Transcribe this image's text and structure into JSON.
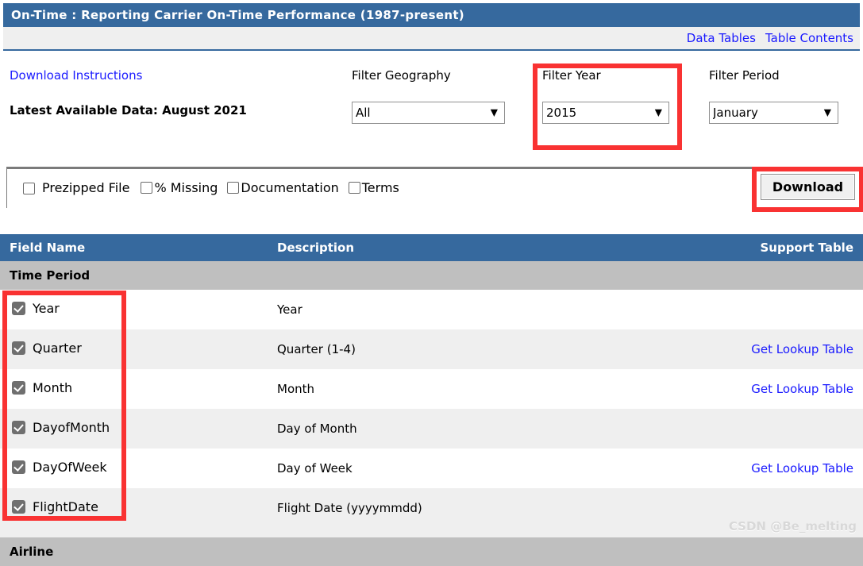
{
  "window": {
    "title": "On-Time : Reporting Carrier On-Time Performance (1987-present)"
  },
  "colors": {
    "header_blue": "#36699e",
    "group_gray": "#bfbfbf",
    "link_blue": "#1a1aff",
    "highlight_red": "#f93232",
    "row_alt": "#efefef"
  },
  "nav_links": [
    {
      "label": "Data Tables"
    },
    {
      "label": "Table Contents"
    }
  ],
  "left_panel": {
    "download_instructions": "Download Instructions",
    "latest_available": "Latest Available Data: August 2021"
  },
  "filters": [
    {
      "id": "geography",
      "label": "Filter Geography",
      "value": "All",
      "options": [
        "All"
      ],
      "highlighted": false
    },
    {
      "id": "year",
      "label": "Filter Year",
      "value": "2015",
      "options": [
        "2015"
      ],
      "highlighted": true
    },
    {
      "id": "period",
      "label": "Filter Period",
      "value": "January",
      "options": [
        "January"
      ],
      "highlighted": false
    }
  ],
  "options": [
    {
      "id": "prezipped",
      "label": "Prezipped File",
      "checked": false
    },
    {
      "id": "missing",
      "label": "% Missing",
      "checked": false
    },
    {
      "id": "documentation",
      "label": "Documentation",
      "checked": false
    },
    {
      "id": "terms",
      "label": "Terms",
      "checked": false
    }
  ],
  "download_button": {
    "label": "Download"
  },
  "table": {
    "columns": {
      "field_name": "Field Name",
      "description": "Description",
      "support_table": "Support Table"
    },
    "groups": [
      {
        "name": "Time Period",
        "rows": [
          {
            "field": "Year",
            "checked": true,
            "description": "Year",
            "support": ""
          },
          {
            "field": "Quarter",
            "checked": true,
            "description": "Quarter (1-4)",
            "support": "Get Lookup Table"
          },
          {
            "field": "Month",
            "checked": true,
            "description": "Month",
            "support": "Get Lookup Table"
          },
          {
            "field": "DayofMonth",
            "checked": true,
            "description": "Day of Month",
            "support": ""
          },
          {
            "field": "DayOfWeek",
            "checked": true,
            "description": "Day of Week",
            "support": "Get Lookup Table"
          },
          {
            "field": "FlightDate",
            "checked": true,
            "description": "Flight Date (yyyymmdd)",
            "support": ""
          }
        ]
      },
      {
        "name": "Airline",
        "rows": []
      }
    ]
  },
  "watermark": "CSDN @Be_melting"
}
